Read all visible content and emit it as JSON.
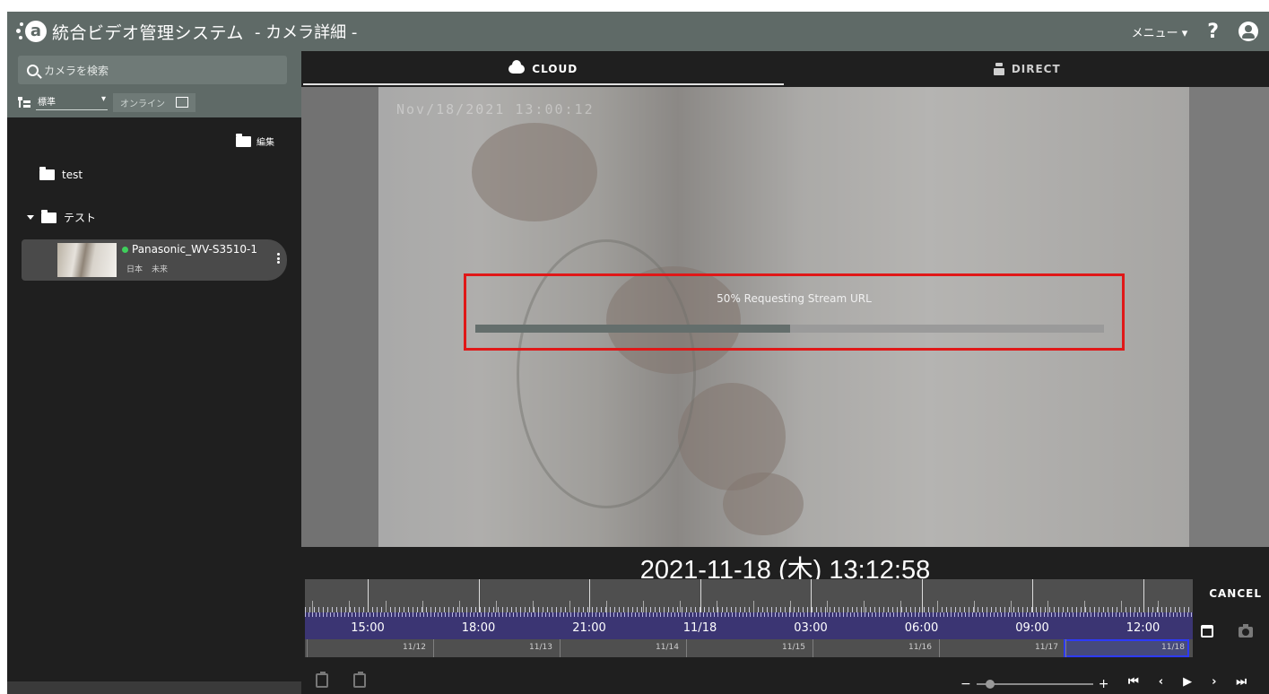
{
  "header": {
    "app_title": "統合ビデオ管理システム",
    "page_subtitle": "- カメラ詳細 -",
    "menu_label": "メニュー ▾",
    "help_label": "?"
  },
  "sidebar": {
    "search_placeholder": "カメラを検索",
    "view_select": "標準",
    "online_filter": "オンライン",
    "edit_label": "編集",
    "tree": [
      {
        "label": "test",
        "expanded": false
      },
      {
        "label": "テスト",
        "expanded": true
      }
    ],
    "camera": {
      "name": "Panasonic_WV-S3510-1",
      "status_color": "#3fcf5c",
      "country": "日本",
      "location": "未来"
    }
  },
  "tabs": [
    {
      "label": "CLOUD",
      "icon": "cloud-icon",
      "active": true
    },
    {
      "label": "DIRECT",
      "icon": "camera-icon",
      "active": false
    }
  ],
  "video": {
    "overlay_timestamp": "Nov/18/2021 13:00:12",
    "loading_text": "50% Requesting Stream URL",
    "progress": 0.5
  },
  "datetime": "2021-11-18 (木) 13:12:58",
  "timeline": {
    "hour_labels": [
      "15:00",
      "18:00",
      "21:00",
      "11/18",
      "03:00",
      "06:00",
      "09:00",
      "12:00"
    ],
    "date_labels": [
      "11/12",
      "11/13",
      "11/14",
      "11/15",
      "11/16",
      "11/17",
      "11/18"
    ],
    "selected_date": "11/18"
  },
  "controls": {
    "cancel_label": "CANCEL",
    "zoom_minus": "−",
    "zoom_plus": "+",
    "nav": [
      "⏮",
      "‹",
      "▶",
      "›",
      "⏭"
    ]
  },
  "colors": {
    "header_bg": "#5f6a67",
    "sidebar_bg": "#1f1f1f",
    "timeline_blue": "#3b3573",
    "highlight_red": "#e01818",
    "selection_blue": "#2d3aff"
  }
}
